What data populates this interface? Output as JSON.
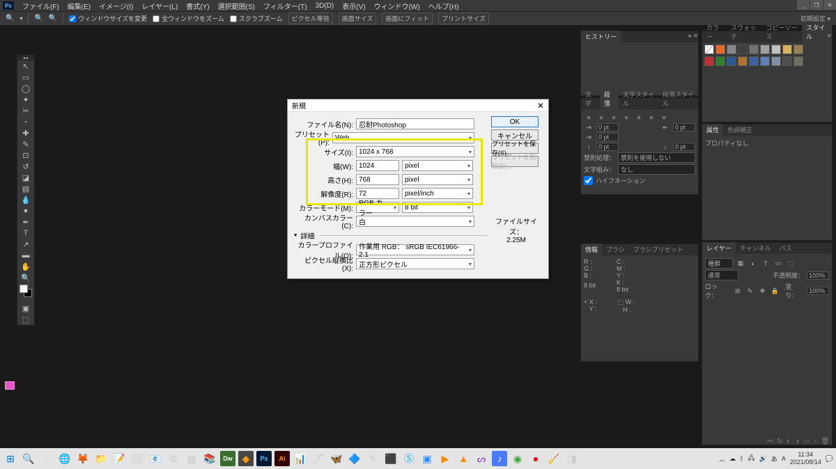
{
  "menubar": {
    "items": [
      "ファイル(F)",
      "編集(E)",
      "イメージ(I)",
      "レイヤー(L)",
      "書式(Y)",
      "選択範囲(S)",
      "フィルター(T)",
      "3D(D)",
      "表示(V)",
      "ウィンドウ(W)",
      "ヘルプ(H)"
    ]
  },
  "optbar": {
    "fit_window": "ウィンドウサイズを変更",
    "all_win": "全ウィンドウをズーム",
    "scrub": "スクラブズーム",
    "pixel": "ピクセル等倍",
    "screen": "画面サイズ",
    "fit": "画面にフィット",
    "print": "プリントサイズ",
    "right": "初期設定"
  },
  "dialog": {
    "title": "新規",
    "filename_label": "ファイル名(N):",
    "filename_value": "忍耐Photoshop",
    "preset_label": "プリセット(P):",
    "preset_value": "Web",
    "size_label": "サイズ(I):",
    "size_value": "1024 x 768",
    "width_label": "幅(W):",
    "width_value": "1024",
    "width_unit": "pixel",
    "height_label": "高さ(H):",
    "height_value": "768",
    "height_unit": "pixel",
    "res_label": "解像度(R):",
    "res_value": "72",
    "res_unit": "pixel/inch",
    "mode_label": "カラーモード(M):",
    "mode_value": "RGB カラー",
    "bit_value": "8 bit",
    "canvas_label": "カンバスカラー(C):",
    "canvas_value": "白",
    "details": "詳細",
    "profile_label": "カラープロファイル(O):",
    "profile_value": "作業用 RGB： sRGB IEC61966-2.1",
    "aspect_label": "ピクセル縦横比(X):",
    "aspect_value": "正方形ピクセル",
    "ok": "OK",
    "cancel": "キャンセル",
    "save_preset": "プリセットを保存(S)...",
    "del_preset": "プリセットを削除(D)...",
    "filesize_label": "ファイルサイズ：",
    "filesize_value": "2.25M"
  },
  "panels": {
    "history": {
      "tab": "ヒストリー"
    },
    "paragraph": {
      "tabs": [
        "文字",
        "段落",
        "文字スタイル",
        "段落スタイル"
      ],
      "val": "0 pt",
      "kinsoku_lbl": "禁則処理：",
      "kinsoku_val": "禁則を使用しない",
      "mojikumi_lbl": "文字組み：",
      "mojikumi_val": "なし",
      "hyphen": "ハイフネーション"
    },
    "info": {
      "tabs": [
        "情報",
        "ブラシ",
        "ブラシプリセット"
      ],
      "r": "R :",
      "g": "G :",
      "b": "B :",
      "bits": "8 bit",
      "c": "C :",
      "m": "M :",
      "y": "Y :",
      "k": "K :",
      "x": "X :",
      "yy": "Y :",
      "w": "W :",
      "h": "H :"
    },
    "style": {
      "tabs": [
        "カラー",
        "スウォッチ",
        "コピーソース",
        "スタイル"
      ]
    },
    "attr": {
      "tabs": [
        "属性",
        "色調補正"
      ],
      "body": "プロパティなし"
    },
    "layers": {
      "tabs": [
        "レイヤー",
        "チャンネル",
        "パス"
      ],
      "kind": "種類",
      "normal": "通常",
      "opacity_lbl": "不透明度：",
      "opacity": "100%",
      "lock_lbl": "ロック：",
      "fill_lbl": "塗り：",
      "fill": "100%"
    }
  },
  "swatches": {
    "row1": [
      "#ffffff00",
      "#e86a2a",
      "#888888",
      "#404040",
      "#707070",
      "#a0a0a0",
      "#c0c0c0",
      "#d8b060",
      "#9a8050"
    ],
    "row2": [
      "#c03030",
      "#308030",
      "#2a5a98",
      "#b07030",
      "#4060a0",
      "#6080b8",
      "#8090a0",
      "#505050",
      "#707060"
    ]
  },
  "taskbar": {
    "time": "11:34",
    "date": "2021/08/14"
  }
}
